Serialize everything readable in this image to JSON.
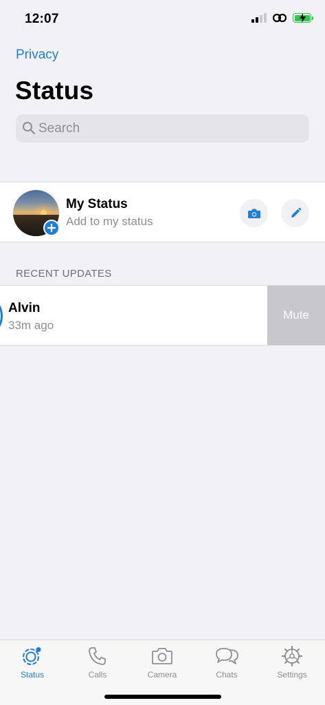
{
  "status_bar": {
    "time": "12:07",
    "icons": [
      "cellular-signal-icon",
      "link-icon",
      "battery-charging-icon"
    ]
  },
  "header": {
    "privacy_link": "Privacy",
    "title": "Status"
  },
  "search": {
    "placeholder": "Search",
    "icon": "search-icon"
  },
  "my_status": {
    "title": "My Status",
    "subtitle": "Add to my status",
    "camera_icon": "camera-icon",
    "edit_icon": "pencil-icon"
  },
  "recent_updates": {
    "header": "RECENT UPDATES",
    "items": [
      {
        "name": "Alvin",
        "time": "33m ago",
        "swipe_action": "Mute"
      }
    ]
  },
  "tab_bar": {
    "active": "Status",
    "tabs": [
      {
        "label": "Status",
        "icon": "status-icon"
      },
      {
        "label": "Calls",
        "icon": "phone-icon"
      },
      {
        "label": "Camera",
        "icon": "camera-icon"
      },
      {
        "label": "Chats",
        "icon": "chat-bubbles-icon"
      },
      {
        "label": "Settings",
        "icon": "gear-icon"
      }
    ]
  },
  "colors": {
    "accent": "#1e7fdb",
    "background": "#f2f1f6",
    "secondary_text": "#8e8e93",
    "swipe_action_bg": "#c7c7cc",
    "battery": "#2dc84d"
  }
}
